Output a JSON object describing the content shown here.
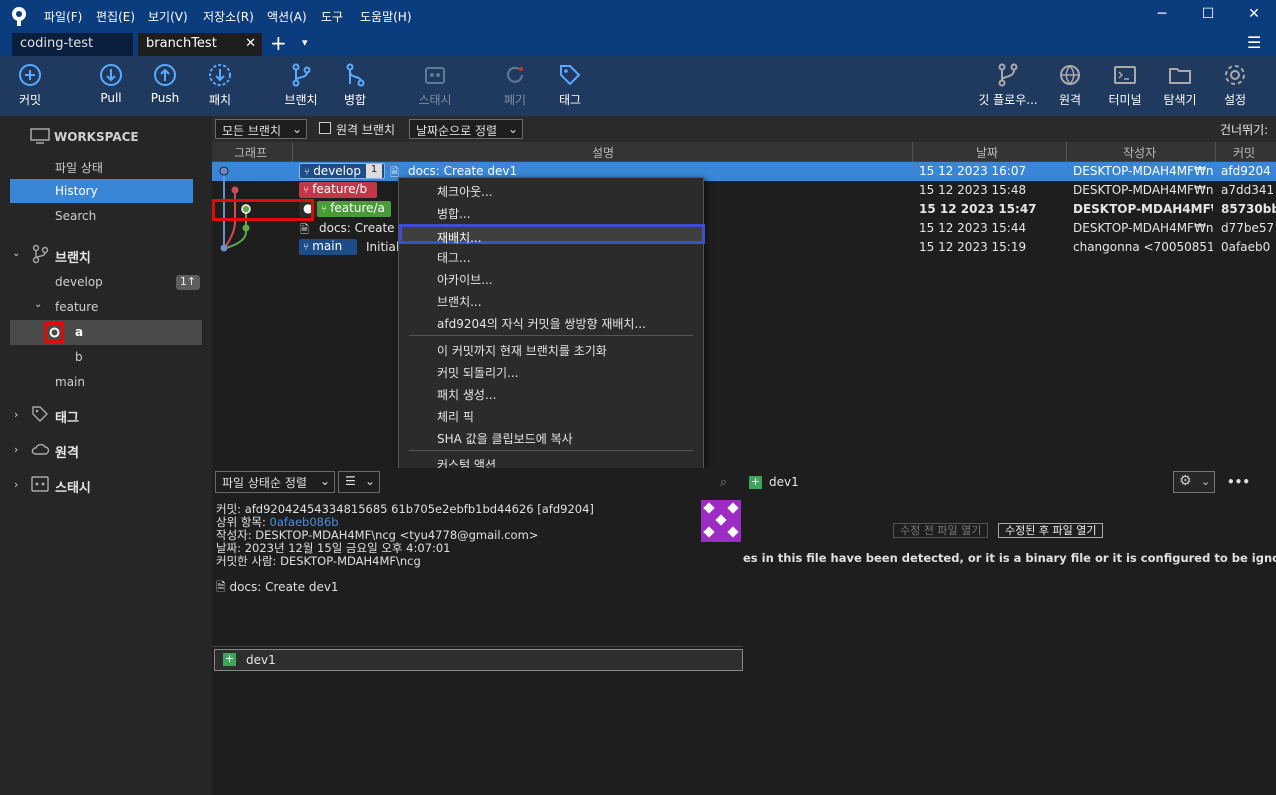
{
  "menu": {
    "items": [
      "파일(F)",
      "편집(E)",
      "보기(V)",
      "저장소(R)",
      "액션(A)",
      "도구",
      "도움말(H)"
    ]
  },
  "window_controls": {
    "minimize": "─",
    "maximize": "☐",
    "close": "✕"
  },
  "tabs": {
    "items": [
      "coding-test",
      "branchTest"
    ],
    "close": "✕",
    "add": "+",
    "more": "▾",
    "hamburger": "☰"
  },
  "toolbar": {
    "commit": "커밋",
    "pull": "Pull",
    "push": "Push",
    "fetch": "패치",
    "branch": "브랜치",
    "merge": "병합",
    "stash": "스태시",
    "discard": "폐기",
    "tag": "태그",
    "gitflow": "깃 플로우...",
    "remote": "원격",
    "terminal": "터미널",
    "explorer": "탐색기",
    "settings": "설정"
  },
  "sidebar": {
    "workspace": "WORKSPACE",
    "file_status": "파일 상태",
    "history": "History",
    "search": "Search",
    "branches": "브랜치",
    "develop": "develop",
    "develop_badge": "1↑",
    "feature": "feature",
    "a": "a",
    "b": "b",
    "main": "main",
    "tags": "태그",
    "remotes": "원격",
    "stashes": "스태시"
  },
  "filterbar": {
    "branch_filter": "모든 브랜치",
    "remote_branch": "원격 브랜치",
    "sort": "날짜순으로 정렬",
    "skip": "건너뛰기:"
  },
  "columns": {
    "graph": "그래프",
    "desc": "설명",
    "date": "날짜",
    "author": "작성자",
    "commit": "커밋"
  },
  "commits": [
    {
      "branch": "develop",
      "count": "1",
      "desc": "docs: Create dev1",
      "date": "15 12 2023 16:07",
      "author": "DESKTOP-MDAH4MF₩nc",
      "hash": "afd9204"
    },
    {
      "branch": "feature/b",
      "desc": "",
      "date": "15 12 2023 15:48",
      "author": "DESKTOP-MDAH4MF₩nc",
      "hash": "a7dd341"
    },
    {
      "branch": "feature/a",
      "desc": "",
      "date": "15 12 2023 15:47",
      "author": "DESKTOP-MDAH4MF₩n",
      "hash": "85730bb"
    },
    {
      "branch": "",
      "desc": "docs: Create a",
      "date": "15 12 2023 15:44",
      "author": "DESKTOP-MDAH4MF₩nc",
      "hash": "d77be57"
    },
    {
      "branch": "main",
      "desc": "Initial",
      "date": "15 12 2023 15:19",
      "author": "changonna <70050851+",
      "hash": "0afaeb0"
    }
  ],
  "context_menu": {
    "checkout": "체크아웃...",
    "merge": "병합...",
    "rebase": "재배치...",
    "tag": "태그...",
    "archive": "아카이브...",
    "branch": "브랜치...",
    "rebase_children": "afd9204의 자식 커밋을 쌍방향 재배치...",
    "reset": "이 커밋까지 현재 브랜치를 초기화",
    "revert": "커밋 되돌리기...",
    "patch": "패치 생성...",
    "cherry": "체리 픽",
    "copy_sha": "SHA 값을 클립보드에 복사",
    "custom": "커스텀 액션"
  },
  "lower": {
    "file_sort": "파일 상태순 정렬",
    "list_view": "☰",
    "commit_line": "커밋: afd92042454334815685 61b705e2ebfb1bd44626 [afd9204]",
    "parent_label": "상위 항목: ",
    "parent_hash": "0afaeb086b",
    "author_line": "작성자: DESKTOP-MDAH4MF\\ncg <tyu4778@gmail.com>",
    "date_line": "날짜: 2023년 12월 15일 금요일 오후 4:07:01",
    "committer_line": "커밋한 사람: DESKTOP-MDAH4MF\\ncg",
    "message": "docs: Create dev1",
    "file": "dev1",
    "right_file": "dev1",
    "open_before": "수정 전 파일 열기",
    "open_after": "수정된 후 파일 열기",
    "notice": "es in this file have been detected, or it is a binary file or it is configured to be ignored by the file",
    "more": "•••"
  }
}
